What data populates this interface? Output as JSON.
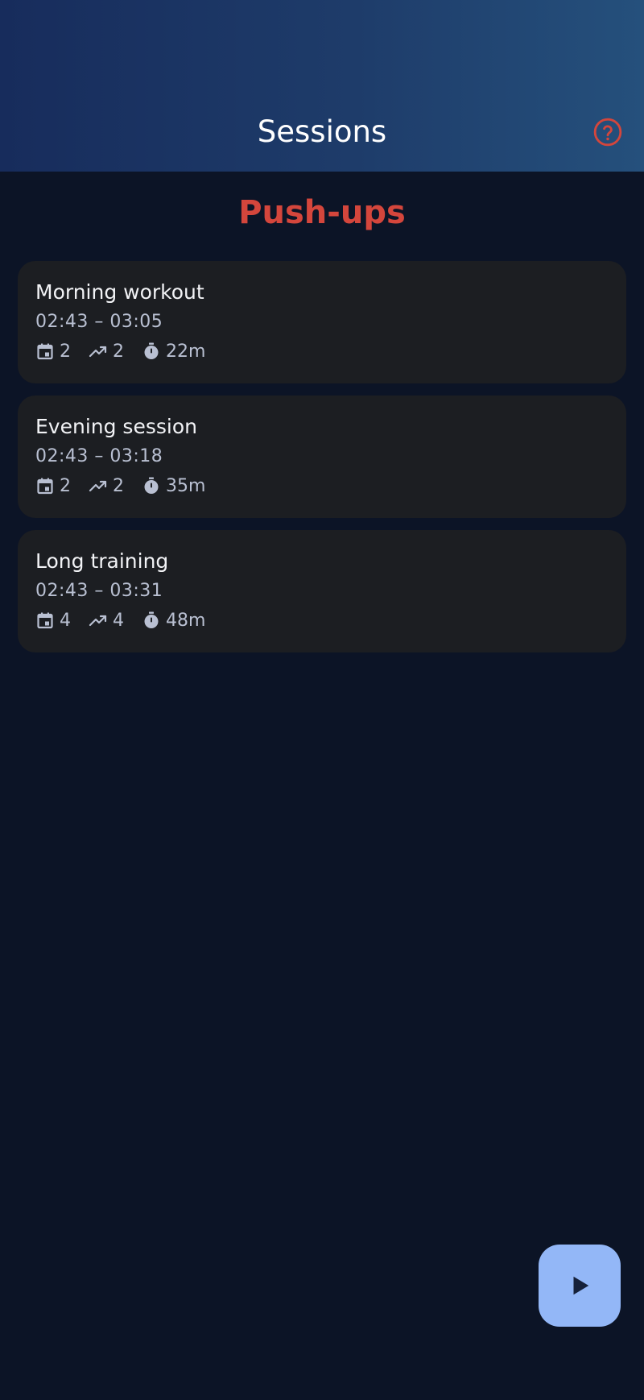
{
  "app_bar": {
    "title": "Sessions",
    "help_icon": "help-circle-icon",
    "gradient_colors": [
      "#172c5c",
      "#25507c"
    ]
  },
  "exercise": {
    "title": "Push-ups",
    "color": "#d4463c"
  },
  "sessions": [
    {
      "name": "Morning workout",
      "time_range": "02:43 – 03:05",
      "sets": "2",
      "progress": "2",
      "duration": "22m"
    },
    {
      "name": "Evening session",
      "time_range": "02:43 – 03:18",
      "sets": "2",
      "progress": "2",
      "duration": "35m"
    },
    {
      "name": "Long training",
      "time_range": "02:43 – 03:31",
      "sets": "4",
      "progress": "4",
      "duration": "48m"
    }
  ],
  "stat_icons": [
    "calendar-icon",
    "trending-up-icon",
    "timer-icon"
  ],
  "fab": {
    "icon": "play-icon",
    "color": "#93b7f7"
  }
}
